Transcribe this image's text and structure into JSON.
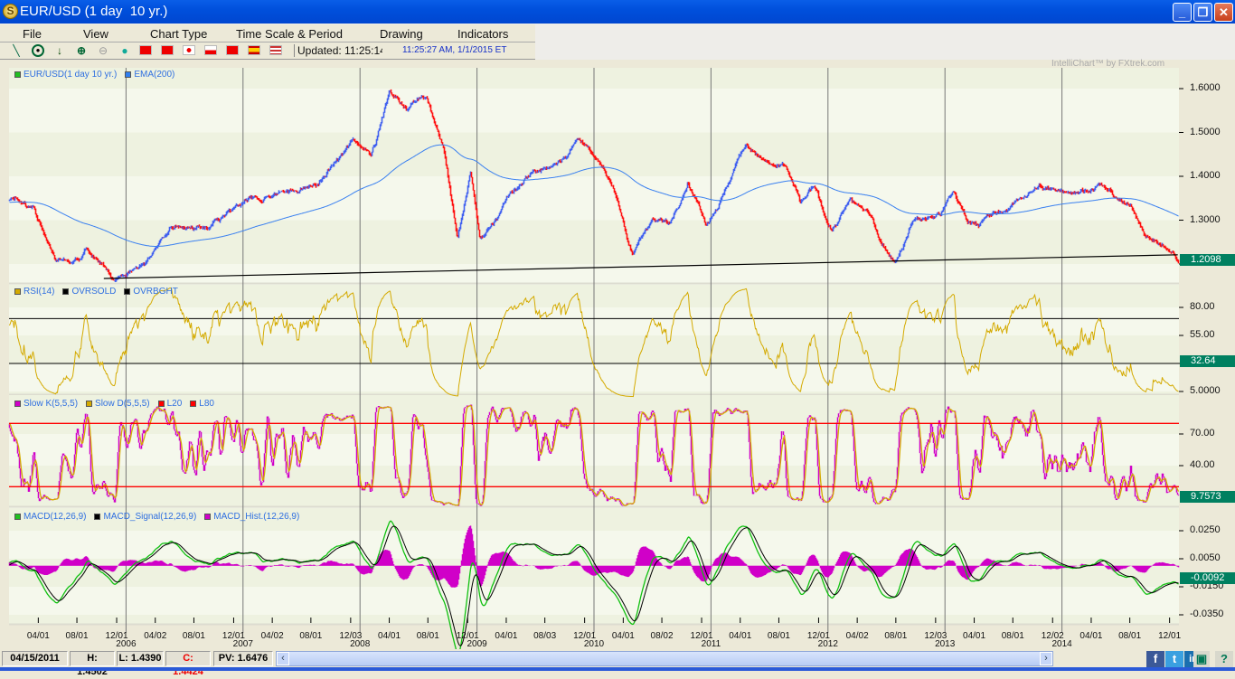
{
  "window": {
    "title": "EUR/USD (1 day  10 yr.)",
    "min": "_",
    "max": "❐",
    "close": "✕"
  },
  "menu": [
    "File",
    "View",
    "Chart Type",
    "Time Scale & Period",
    "Drawing",
    "Indicators"
  ],
  "toolbar": {
    "updated": "Updated: 11:25:14",
    "clock": "11:25:27 AM, 1/1/2015 ET",
    "tools": [
      "line-tool",
      "crosshair-tool",
      "down-arrow-tool",
      "zoom-in",
      "zoom-out",
      "green-ball"
    ],
    "flags": [
      "china",
      "hong-kong",
      "japan",
      "poland",
      "turkey",
      "spain",
      "usa"
    ]
  },
  "credit": "IntelliChart™ by FXtrek.com",
  "legends": {
    "price": [
      {
        "label": "EUR/USD(1 day  10 yr.)",
        "color": "#20c020"
      },
      {
        "label": "EMA(200)",
        "color": "#3080f0"
      }
    ],
    "rsi": [
      {
        "label": "RSI(14)",
        "color": "#d4aa00"
      },
      {
        "label": "OVRSOLD",
        "color": "#000000"
      },
      {
        "label": "OVRBGHT",
        "color": "#000000"
      }
    ],
    "stoch": [
      {
        "label": "Slow K(5,5,5)",
        "color": "#d000c8"
      },
      {
        "label": "Slow D(5,5,5)",
        "color": "#d4aa00"
      },
      {
        "label": "L20",
        "color": "#ff0000"
      },
      {
        "label": "L80",
        "color": "#ff0000"
      }
    ],
    "macd": [
      {
        "label": "MACD(12,26,9)",
        "color": "#20c020"
      },
      {
        "label": "MACD_Signal(12,26,9)",
        "color": "#000000"
      },
      {
        "label": "MACD_Hist.(12,26,9)",
        "color": "#d000c8"
      }
    ]
  },
  "status": {
    "date": "04/15/2011",
    "high": "H: 1.4502",
    "low": "L: 1.4390",
    "close": "C: 1.4424",
    "pv": "PV: 1.6476"
  },
  "chart_data": {
    "type": "line",
    "title": "EUR/USD (1 day 10 yr.)",
    "xlim": [
      2005.0,
      2015.0
    ],
    "year_lines": [
      2006,
      2007,
      2008,
      2009,
      2010,
      2011,
      2012,
      2013,
      2014
    ],
    "x_ticks": [
      {
        "label": "04/01",
        "t": 2005.25
      },
      {
        "label": "08/01",
        "t": 2005.58
      },
      {
        "label": "12/01",
        "t": 2005.92
      },
      {
        "label": "04/02",
        "t": 2006.25
      },
      {
        "label": "08/01",
        "t": 2006.58
      },
      {
        "label": "12/01",
        "t": 2006.92
      },
      {
        "label": "04/02",
        "t": 2007.25
      },
      {
        "label": "08/01",
        "t": 2007.58
      },
      {
        "label": "12/03",
        "t": 2007.92
      },
      {
        "label": "04/01",
        "t": 2008.25
      },
      {
        "label": "08/01",
        "t": 2008.58
      },
      {
        "label": "12/01",
        "t": 2008.92
      },
      {
        "label": "04/01",
        "t": 2009.25
      },
      {
        "label": "08/03",
        "t": 2009.58
      },
      {
        "label": "12/01",
        "t": 2009.92
      },
      {
        "label": "04/01",
        "t": 2010.25
      },
      {
        "label": "08/02",
        "t": 2010.58
      },
      {
        "label": "12/01",
        "t": 2010.92
      },
      {
        "label": "04/01",
        "t": 2011.25
      },
      {
        "label": "08/01",
        "t": 2011.58
      },
      {
        "label": "12/01",
        "t": 2011.92
      },
      {
        "label": "04/02",
        "t": 2012.25
      },
      {
        "label": "08/01",
        "t": 2012.58
      },
      {
        "label": "12/03",
        "t": 2012.92
      },
      {
        "label": "04/01",
        "t": 2013.25
      },
      {
        "label": "08/01",
        "t": 2013.58
      },
      {
        "label": "12/02",
        "t": 2013.92
      },
      {
        "label": "04/01",
        "t": 2014.25
      },
      {
        "label": "08/01",
        "t": 2014.58
      },
      {
        "label": "12/01",
        "t": 2014.92
      }
    ],
    "year_labels": [
      {
        "label": "2006",
        "t": 2006.0
      },
      {
        "label": "2007",
        "t": 2007.0
      },
      {
        "label": "2008",
        "t": 2008.0
      },
      {
        "label": "2009",
        "t": 2009.0
      },
      {
        "label": "2010",
        "t": 2010.0
      },
      {
        "label": "2011",
        "t": 2011.0
      },
      {
        "label": "2012",
        "t": 2012.0
      },
      {
        "label": "2013",
        "t": 2013.0
      },
      {
        "label": "2014",
        "t": 2014.0
      }
    ],
    "price": {
      "y_ticks": [
        "1.6000",
        "1.5000",
        "1.4000",
        "1.3000",
        "1.2000"
      ],
      "anchors": [
        [
          2005.0,
          1.338
        ],
        [
          2005.2,
          1.338
        ],
        [
          2005.39,
          1.214
        ],
        [
          2005.54,
          1.204
        ],
        [
          2005.66,
          1.245
        ],
        [
          2005.78,
          1.204
        ],
        [
          2005.89,
          1.173
        ],
        [
          2006.16,
          1.204
        ],
        [
          2006.39,
          1.286
        ],
        [
          2006.7,
          1.27
        ],
        [
          2007.01,
          1.328
        ],
        [
          2007.32,
          1.359
        ],
        [
          2007.63,
          1.379
        ],
        [
          2007.94,
          1.482
        ],
        [
          2008.09,
          1.462
        ],
        [
          2008.25,
          1.596
        ],
        [
          2008.4,
          1.555
        ],
        [
          2008.56,
          1.596
        ],
        [
          2008.71,
          1.472
        ],
        [
          2008.83,
          1.256
        ],
        [
          2008.94,
          1.41
        ],
        [
          2009.02,
          1.256
        ],
        [
          2009.14,
          1.287
        ],
        [
          2009.25,
          1.348
        ],
        [
          2009.41,
          1.4
        ],
        [
          2009.64,
          1.421
        ],
        [
          2009.87,
          1.493
        ],
        [
          2010.02,
          1.431
        ],
        [
          2010.18,
          1.369
        ],
        [
          2010.33,
          1.214
        ],
        [
          2010.49,
          1.307
        ],
        [
          2010.64,
          1.287
        ],
        [
          2010.8,
          1.4
        ],
        [
          2010.95,
          1.307
        ],
        [
          2011.1,
          1.369
        ],
        [
          2011.3,
          1.482
        ],
        [
          2011.49,
          1.431
        ],
        [
          2011.64,
          1.41
        ],
        [
          2011.76,
          1.328
        ],
        [
          2011.88,
          1.359
        ],
        [
          2012.03,
          1.276
        ],
        [
          2012.19,
          1.338
        ],
        [
          2012.34,
          1.307
        ],
        [
          2012.46,
          1.245
        ],
        [
          2012.57,
          1.214
        ],
        [
          2012.73,
          1.307
        ],
        [
          2012.96,
          1.318
        ],
        [
          2013.07,
          1.359
        ],
        [
          2013.19,
          1.297
        ],
        [
          2013.34,
          1.307
        ],
        [
          2013.5,
          1.318
        ],
        [
          2013.65,
          1.348
        ],
        [
          2013.81,
          1.369
        ],
        [
          2013.96,
          1.369
        ],
        [
          2014.19,
          1.379
        ],
        [
          2014.31,
          1.39
        ],
        [
          2014.42,
          1.365
        ],
        [
          2014.58,
          1.328
        ],
        [
          2014.73,
          1.266
        ],
        [
          2014.88,
          1.245
        ],
        [
          2014.99,
          1.21
        ]
      ],
      "trendline": [
        [
          2005.81,
          1.167
        ],
        [
          2014.99,
          1.221
        ]
      ],
      "last": "1.2098"
    },
    "rsi": {
      "y_ticks": [
        "80.00",
        "55.00",
        "30.00",
        "5.0000"
      ],
      "overbought": 70,
      "oversold": 30,
      "last": "32.64"
    },
    "stoch": {
      "y_ticks": [
        "70.00",
        "40.00"
      ],
      "l80": 80,
      "l20": 20,
      "last": "9.7573"
    },
    "macd": {
      "y_ticks": [
        "0.0250",
        "0.0050",
        "-0.0150",
        "-0.0350"
      ],
      "last": "-0.0092"
    }
  }
}
